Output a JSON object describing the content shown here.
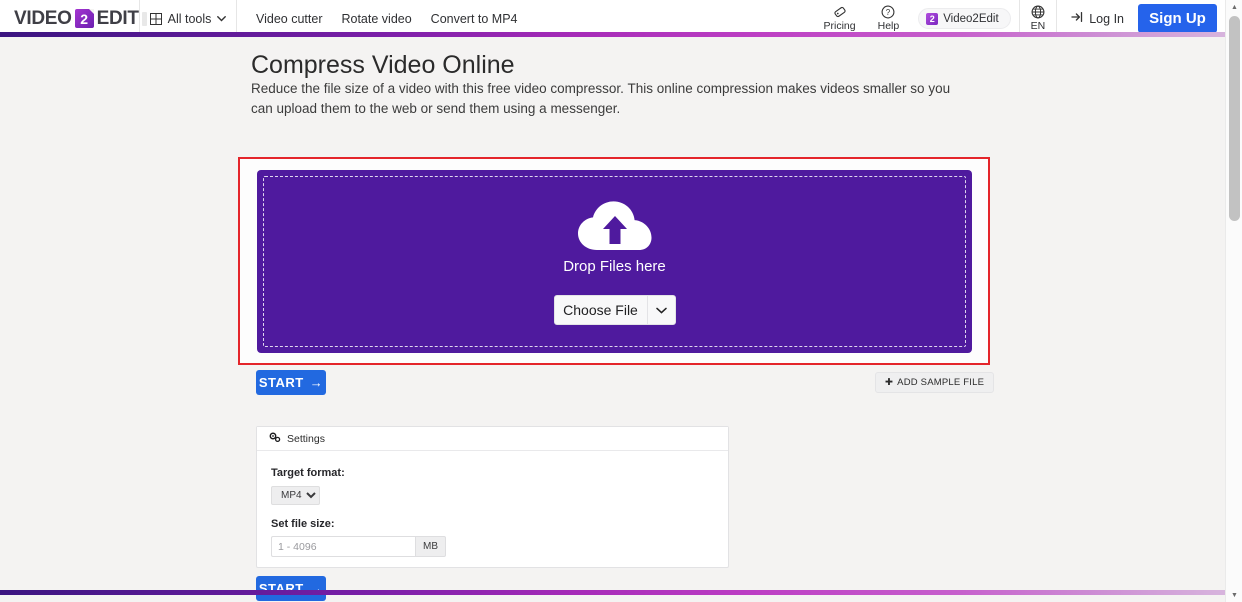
{
  "header": {
    "logo": {
      "part1": "VIDEO",
      "badge": "2",
      "part2": "EDIT"
    },
    "all_tools": {
      "label": "All tools",
      "icon": "grid-icon",
      "chevron": "⌄"
    },
    "nav_links": [
      {
        "label": "Video cutter"
      },
      {
        "label": "Rotate video"
      },
      {
        "label": "Convert to MP4"
      }
    ],
    "pricing": {
      "label": "Pricing",
      "icon": "price-tag-icon"
    },
    "help": {
      "label": "Help",
      "icon": "question-circle-icon"
    },
    "brand_pill": {
      "badge": "2",
      "label": "Video2Edit"
    },
    "language": {
      "label": "EN",
      "icon": "globe-icon"
    },
    "login": {
      "label": "Log In",
      "icon": "login-arrow-icon"
    },
    "signup": {
      "label": "Sign Up"
    }
  },
  "main": {
    "title": "Compress Video Online",
    "subtitle": "Reduce the file size of a video with this free video compressor. This online compression makes videos smaller so you can upload them to the web or send them using a messenger.",
    "dropzone": {
      "icon": "cloud-upload-icon",
      "label": "Drop Files here",
      "choose_file": "Choose File",
      "choose_file_chevron": "⌄"
    },
    "start_top": {
      "label": "START",
      "arrow": "→"
    },
    "start_bottom": {
      "label": "START",
      "arrow": "→"
    },
    "add_sample": {
      "plus": "✚",
      "label": "ADD SAMPLE FILE"
    },
    "settings": {
      "icon": "gears-icon",
      "title": "Settings",
      "target_format": {
        "label": "Target format:",
        "value": "MP4",
        "options": [
          "MP4"
        ]
      },
      "file_size": {
        "label": "Set file size:",
        "value": "",
        "placeholder": "1 - 4096",
        "unit": "MB"
      }
    }
  },
  "scrollbar": {
    "up": "▲",
    "down": "▼"
  },
  "colors": {
    "accent_purple": "#4f1a9e",
    "primary_blue": "#2269e0",
    "annotation_red": "#e4252b",
    "page_bg": "#f4f3f2"
  }
}
